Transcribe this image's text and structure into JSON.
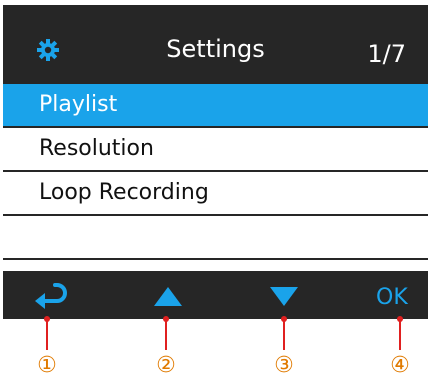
{
  "header": {
    "icon": "gear-icon",
    "title": "Settings",
    "page_indicator": "1/7"
  },
  "menu": {
    "selected_index": 0,
    "items": [
      {
        "label": "Playlist"
      },
      {
        "label": "Resolution"
      },
      {
        "label": "Loop Recording"
      },
      {
        "label": ""
      }
    ]
  },
  "footer": {
    "buttons": [
      {
        "icon": "back-arrow-icon"
      },
      {
        "icon": "up-triangle-icon"
      },
      {
        "icon": "down-triangle-icon"
      },
      {
        "label": "OK"
      }
    ]
  },
  "callouts": [
    "①",
    "②",
    "③",
    "④"
  ],
  "colors": {
    "header_bg": "#262626",
    "accent": "#1aa3ea",
    "callout_line": "#e02020",
    "callout_number": "#e07a00"
  }
}
